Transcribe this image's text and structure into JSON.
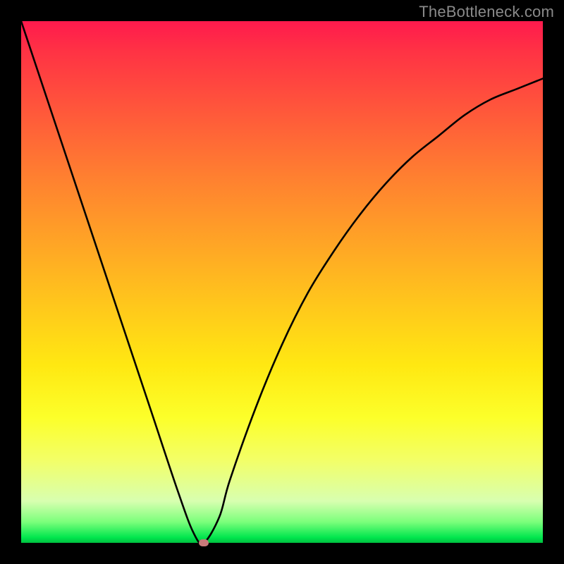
{
  "watermark": "TheBottleneck.com",
  "colors": {
    "frame": "#000000",
    "curve": "#000000",
    "marker": "#c97a7a"
  },
  "chart_data": {
    "type": "line",
    "title": "",
    "xlabel": "",
    "ylabel": "",
    "xlim": [
      0,
      100
    ],
    "ylim": [
      0,
      100
    ],
    "grid": false,
    "legend": false,
    "series": [
      {
        "name": "bottleneck-curve",
        "x": [
          0,
          5,
          10,
          15,
          20,
          25,
          30,
          33,
          35,
          38,
          40,
          45,
          50,
          55,
          60,
          65,
          70,
          75,
          80,
          85,
          90,
          95,
          100
        ],
        "y": [
          100,
          85,
          70,
          55,
          40,
          25,
          10,
          2,
          0,
          5,
          12,
          26,
          38,
          48,
          56,
          63,
          69,
          74,
          78,
          82,
          85,
          87,
          89
        ]
      }
    ],
    "annotations": [
      {
        "type": "marker",
        "x": 35,
        "y": 0,
        "shape": "rounded-rect",
        "color": "#c97a7a"
      }
    ],
    "background_gradient": [
      "#ff1a4d",
      "#ffa326",
      "#fcff2a",
      "#00e64d"
    ]
  }
}
